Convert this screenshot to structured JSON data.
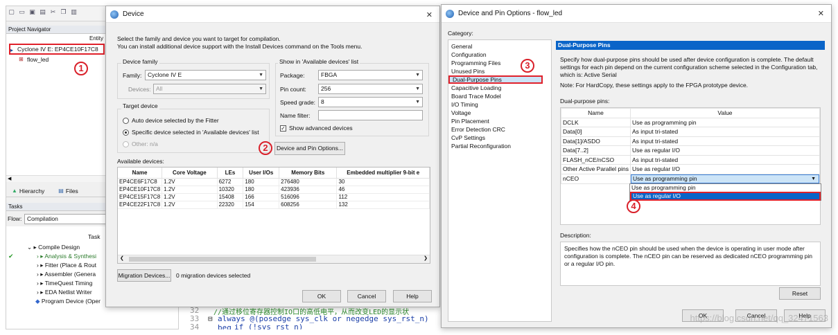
{
  "main": {
    "project_navigator": "Project Navigator",
    "entity_header": "Entity",
    "device_entry": "Cyclone IV E: EP4CE10F17C8",
    "top_entity": "flow_led",
    "tabs": [
      "Hierarchy",
      "Files"
    ],
    "tasks_header": "Tasks",
    "flow_label": "Flow:",
    "flow_value": "Compilation",
    "task_header": "Task",
    "tasks": [
      "Compile Design",
      "Analysis & Synthesi",
      "Fitter (Place & Rout",
      "Assembler (Genera",
      "TimeQuest Timing",
      "EDA Netlist Writer",
      "Program Device (Oper"
    ]
  },
  "code": {
    "lines": [
      {
        "num": "32",
        "text": "//通过移位寄存器控制IO口的高低电平，从而改变LED的显示状"
      },
      {
        "num": "33",
        "text": "always @(posedge sys_clk or negedge sys_rst_n) beg"
      },
      {
        "num": "34",
        "text": "if (!sys_rst_n)"
      }
    ]
  },
  "device_dialog": {
    "title": "Device",
    "intro_line1": "Select the family and device you want to target for compilation.",
    "intro_line2": "You can install additional device support with the Install Devices command on the Tools menu.",
    "family_group": "Device family",
    "family_label": "Family:",
    "family_value": "Cyclone IV E",
    "devices_label": "Devices:",
    "devices_value": "All",
    "target_group": "Target device",
    "radio_auto": "Auto device selected by the Fitter",
    "radio_specific": "Specific device selected in 'Available devices' list",
    "radio_other": "Other:  n/a",
    "show_group": "Show in 'Available devices' list",
    "package_label": "Package:",
    "package_value": "FBGA",
    "pin_count_label": "Pin count:",
    "pin_count_value": "256",
    "speed_label": "Speed grade:",
    "speed_value": "8",
    "filter_label": "Name filter:",
    "show_advanced": "Show advanced devices",
    "pin_options_button": "Device and Pin Options...",
    "available_label": "Available devices:",
    "columns": [
      "Name",
      "Core Voltage",
      "LEs",
      "User I/Os",
      "Memory Bits",
      "Embedded multiplier 9-bit e"
    ],
    "rows": [
      [
        "EP4CE6F17C8",
        "1.2V",
        "6272",
        "180",
        "276480",
        "30"
      ],
      [
        "EP4CE10F17C8",
        "1.2V",
        "10320",
        "180",
        "423936",
        "46"
      ],
      [
        "EP4CE15F17C8",
        "1.2V",
        "15408",
        "166",
        "516096",
        "112"
      ],
      [
        "EP4CE22F17C8",
        "1.2V",
        "22320",
        "154",
        "608256",
        "132"
      ]
    ],
    "migration_button": "Migration Devices...",
    "migration_status": "0 migration devices selected",
    "ok": "OK",
    "cancel": "Cancel",
    "help": "Help"
  },
  "pin_dialog": {
    "title": "Device and Pin Options - flow_led",
    "category_label": "Category:",
    "categories": [
      "General",
      "Configuration",
      "Programming Files",
      "Unused Pins",
      "Dual-Purpose Pins",
      "Capacitive Loading",
      "Board Trace Model",
      "I/O Timing",
      "Voltage",
      "Pin Placement",
      "Error Detection CRC",
      "CvP Settings",
      "Partial Reconfiguration"
    ],
    "section_title": "Dual-Purpose Pins",
    "desc1": "Specify how dual-purpose pins should be used after device configuration is complete. The default",
    "desc2": "settings for each pin depend on the current configuration scheme selected in the Configuration tab,",
    "desc3": "which is:  Active Serial",
    "note": "Note: For HardCopy, these settings apply to the FPGA prototype device.",
    "table_label": "Dual-purpose pins:",
    "col_name": "Name",
    "col_value": "Value",
    "pins": [
      [
        "DCLK",
        "Use as programming pin"
      ],
      [
        "Data[0]",
        "As input tri-stated"
      ],
      [
        "Data[1]/ASDO",
        "As input tri-stated"
      ],
      [
        "Data[7..2]",
        "Use as regular I/O"
      ],
      [
        "FLASH_nCE/nCSO",
        "As input tri-stated"
      ],
      [
        "Other Active Parallel pins",
        "Use as regular I/O"
      ],
      [
        "nCEO",
        "Use as programming pin"
      ]
    ],
    "dropdown_options": [
      "Use as programming pin",
      "Use as regular I/O"
    ],
    "description_label": "Description:",
    "description": "Specifies how the nCEO pin should be used when the device is operating in user mode after configuration is complete. The nCEO pin can be reserved as dedicated nCEO programming pin or a regular I/O pin.",
    "reset": "Reset",
    "ok": "OK",
    "cancel": "Cancel",
    "help": "Help"
  },
  "annotations": [
    "1",
    "2",
    "3",
    "4"
  ],
  "watermark": "https://blog.csdn.net/qq_32471563"
}
